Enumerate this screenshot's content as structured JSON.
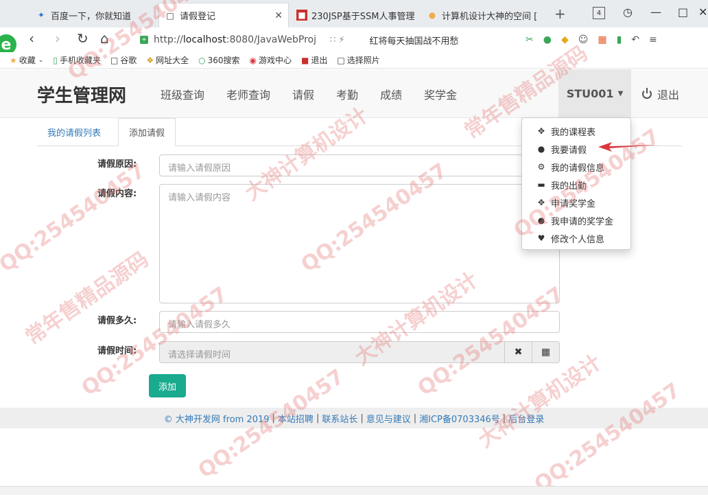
{
  "browser": {
    "tabs": [
      {
        "title": "百度一下，你就知道",
        "icon": "paw-icon",
        "icon_color": "#2a6fd6"
      },
      {
        "title": "请假登记",
        "icon": "page-icon"
      },
      {
        "title": "230JSP基于SSM人事管理",
        "icon": "red-square-icon",
        "icon_color": "#c9302c"
      },
      {
        "title": "计算机设计大神的空间 [",
        "icon": "bulb-icon",
        "icon_color": "#f0ad4e"
      }
    ],
    "tab_count": "4",
    "url_host": "localhost",
    "url_rest": ":8080/JavaWebProj",
    "promo": "红将每天抽国战不用愁",
    "bookmarks": [
      {
        "label": "收藏",
        "icon": "star-icon"
      },
      {
        "label": "手机收藏夹",
        "icon": "phone-icon"
      },
      {
        "label": "谷歌",
        "icon": "page-icon"
      },
      {
        "label": "网址大全",
        "icon": "globe-icon"
      },
      {
        "label": "360搜索",
        "icon": "search-icon"
      },
      {
        "label": "游戏中心",
        "icon": "game-icon"
      },
      {
        "label": "退出",
        "icon": "exit-icon"
      },
      {
        "label": "选择照片",
        "icon": "page-icon"
      }
    ]
  },
  "site": {
    "brand": "学生管理网",
    "menu": [
      "班级查询",
      "老师查询",
      "请假",
      "考勤",
      "成绩",
      "奖学金"
    ],
    "user": "STU001",
    "logout": "退出"
  },
  "tabs": {
    "list": "我的请假列表",
    "add": "添加请假"
  },
  "form": {
    "reason_label": "请假原因:",
    "reason_placeholder": "请输入请假原因",
    "content_label": "请假内容:",
    "content_placeholder": "请输入请假内容",
    "duration_label": "请假多久:",
    "duration_placeholder": "请输入请假多久",
    "time_label": "请假时间:",
    "time_placeholder": "请选择请假时间",
    "submit": "添加"
  },
  "dropdown": {
    "items": [
      {
        "label": "我的课程表",
        "icon": "move-icon"
      },
      {
        "label": "我要请假",
        "icon": "user-icon"
      },
      {
        "label": "我的请假信息",
        "icon": "cog-icon"
      },
      {
        "label": "我的出勤",
        "icon": "card-icon"
      },
      {
        "label": "申请奖学金",
        "icon": "move-icon"
      },
      {
        "label": "我申请的奖学金",
        "icon": "user-icon"
      },
      {
        "label": "修改个人信息",
        "icon": "heart-icon"
      }
    ]
  },
  "footer": {
    "copyright": "© 大神开发网 from 2019",
    "links": [
      "本站招聘",
      "联系站长",
      "意见与建议",
      "湘ICP备0703346号",
      "后台登录"
    ]
  },
  "watermark": {
    "qq": "QQ:254540457",
    "text1": "常年售精品源码",
    "text2": "大神计算机设计"
  },
  "colors": {
    "accent": "#1aaa8e",
    "link": "#337ab7",
    "arrow": "#d9363e"
  }
}
